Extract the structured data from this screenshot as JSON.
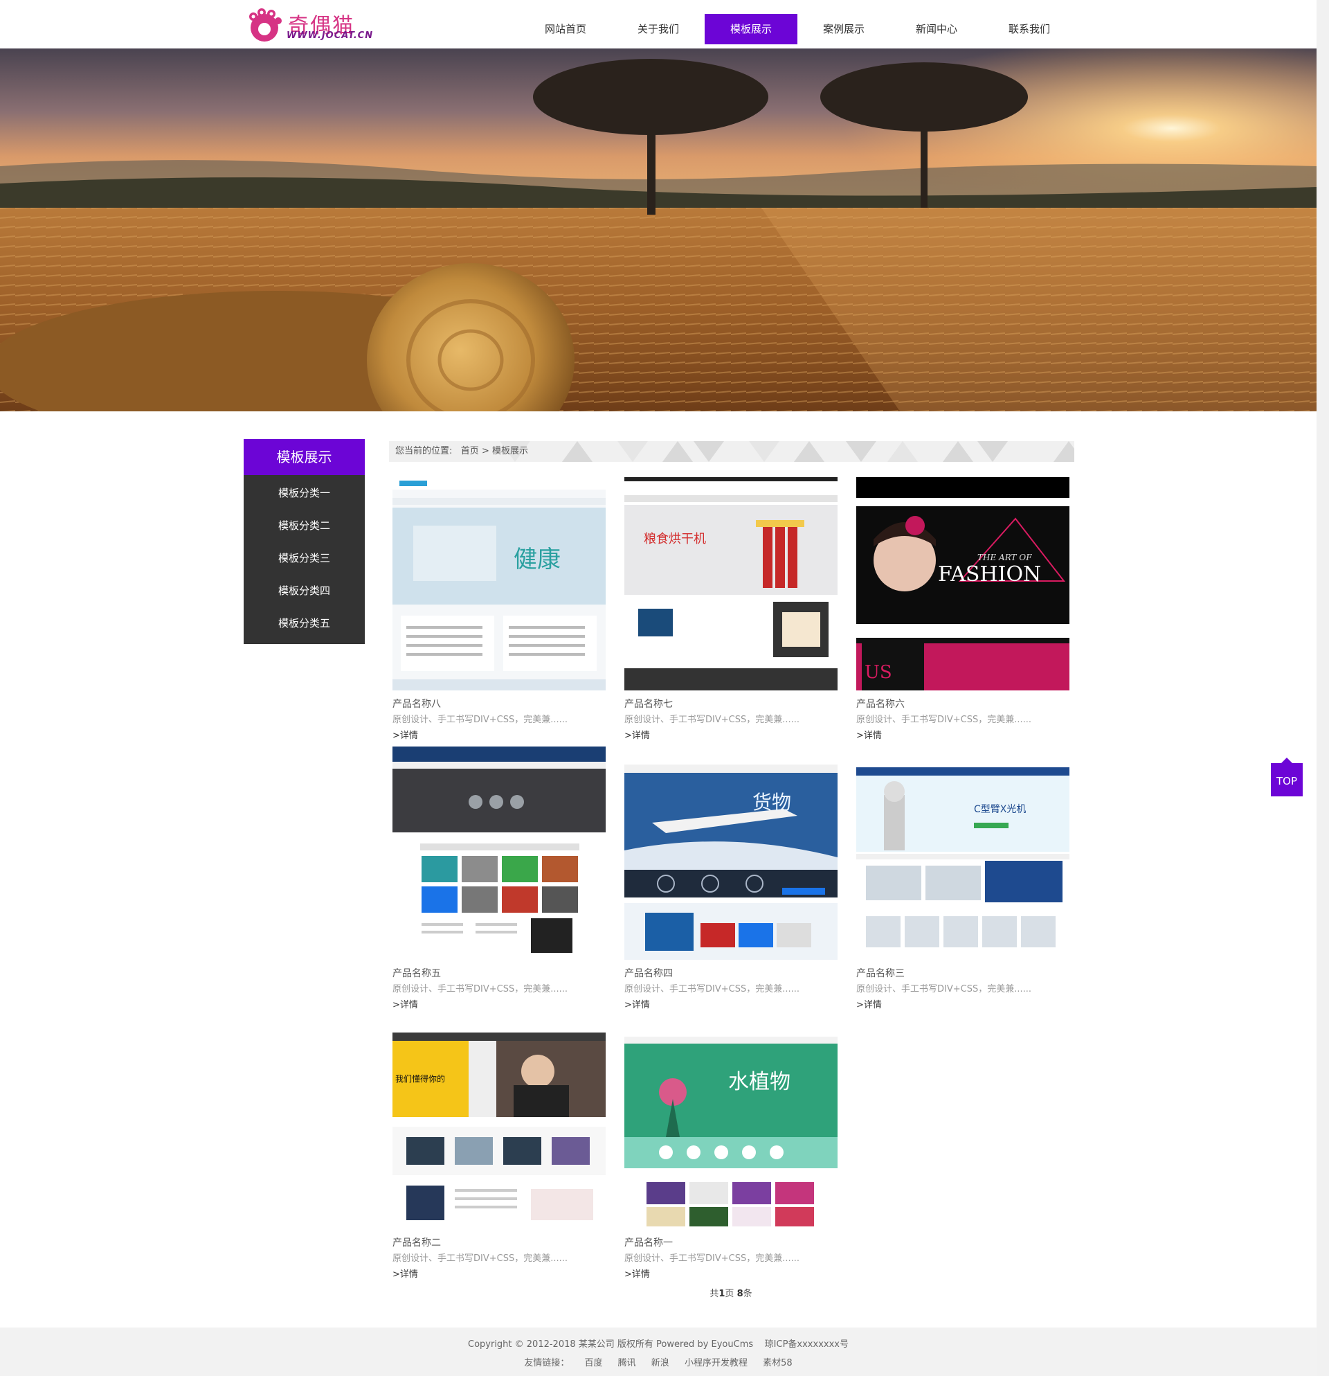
{
  "brand": {
    "logo_text": "奇偶猫",
    "logo_url": "WWW.JOCAT.CN"
  },
  "nav": {
    "items": [
      {
        "label": "网站首页"
      },
      {
        "label": "关于我们"
      },
      {
        "label": "模板展示"
      },
      {
        "label": "案例展示"
      },
      {
        "label": "新闻中心"
      },
      {
        "label": "联系我们"
      }
    ],
    "active_index": 2
  },
  "sidebar": {
    "title": "模板展示",
    "items": [
      {
        "label": "模板分类一"
      },
      {
        "label": "模板分类二"
      },
      {
        "label": "模板分类三"
      },
      {
        "label": "模板分类四"
      },
      {
        "label": "模板分类五"
      }
    ]
  },
  "breadcrumb": {
    "prefix": "您当前的位置:",
    "home": "首页",
    "separator": ">",
    "current": "模板展示"
  },
  "products": [
    {
      "title": "产品名称八",
      "desc": "原创设计、手工书写DIV+CSS，完美兼......",
      "more": ">详情",
      "theme": "health"
    },
    {
      "title": "产品名称七",
      "desc": "原创设计、手工书写DIV+CSS，完美兼......",
      "more": ">详情",
      "theme": "dryer"
    },
    {
      "title": "产品名称六",
      "desc": "原创设计、手工书写DIV+CSS，完美兼......",
      "more": ">详情",
      "theme": "fashion"
    },
    {
      "title": "产品名称五",
      "desc": "原创设计、手工书写DIV+CSS，完美兼......",
      "more": ">详情",
      "theme": "electronic"
    },
    {
      "title": "产品名称四",
      "desc": "原创设计、手工书写DIV+CSS，完美兼......",
      "more": ">详情",
      "theme": "logistics"
    },
    {
      "title": "产品名称三",
      "desc": "原创设计、手工书写DIV+CSS，完美兼......",
      "more": ">详情",
      "theme": "medical"
    },
    {
      "title": "产品名称二",
      "desc": "原创设计、手工书写DIV+CSS，完美兼......",
      "more": ">详情",
      "theme": "printing"
    },
    {
      "title": "产品名称一",
      "desc": "原创设计、手工书写DIV+CSS，完美兼......",
      "more": ">详情",
      "theme": "plants"
    }
  ],
  "pager": {
    "prefix": "共",
    "pages": "1",
    "mid": "页",
    "count": "8",
    "suffix": "条"
  },
  "top_button": "TOP",
  "footer": {
    "copyright": "Copyright © 2012-2018 某某公司 版权所有 Powered by EyouCms",
    "icp": "琼ICP备xxxxxxxx号",
    "links_label": "友情链接：",
    "links": [
      "百度",
      "腾讯",
      "新浪",
      "小程序开发教程",
      "素材58"
    ]
  },
  "colors": {
    "accent": "#6c05d6",
    "sidebar_bg": "#333333",
    "footer_bg": "#f2f2f2"
  }
}
